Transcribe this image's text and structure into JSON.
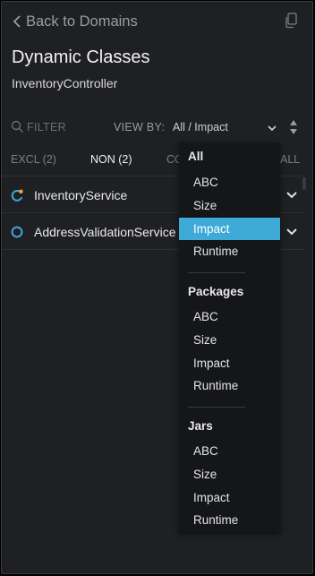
{
  "header": {
    "back_label": "Back to Domains",
    "title": "Dynamic Classes",
    "subtitle": "InventoryController"
  },
  "toolbar": {
    "filter_placeholder": "FILTER",
    "view_by_label": "VIEW BY:",
    "view_by_value": "All / Impact"
  },
  "tabs": [
    {
      "label": "EXCL (2)",
      "active": false
    },
    {
      "label": "NON (2)",
      "active": true
    },
    {
      "label": "CO",
      "active": false
    },
    {
      "label": "ALL",
      "active": false
    }
  ],
  "list": [
    {
      "label": "InventoryService",
      "icon": "partial-circle-icon",
      "icon_color": "#3fa9d8",
      "dot_color": "#f0a030"
    },
    {
      "label": "AddressValidationService",
      "icon": "ring-icon",
      "icon_color": "#3fa9d8"
    }
  ],
  "dropdown": {
    "groups": [
      {
        "label": "All",
        "items": [
          "ABC",
          "Size",
          "Impact",
          "Runtime"
        ]
      },
      {
        "label": "Packages",
        "items": [
          "ABC",
          "Size",
          "Impact",
          "Runtime"
        ]
      },
      {
        "label": "Jars",
        "items": [
          "ABC",
          "Size",
          "Impact",
          "Runtime"
        ]
      }
    ],
    "selected": "All / Impact",
    "accent": "#3fa9d8"
  }
}
